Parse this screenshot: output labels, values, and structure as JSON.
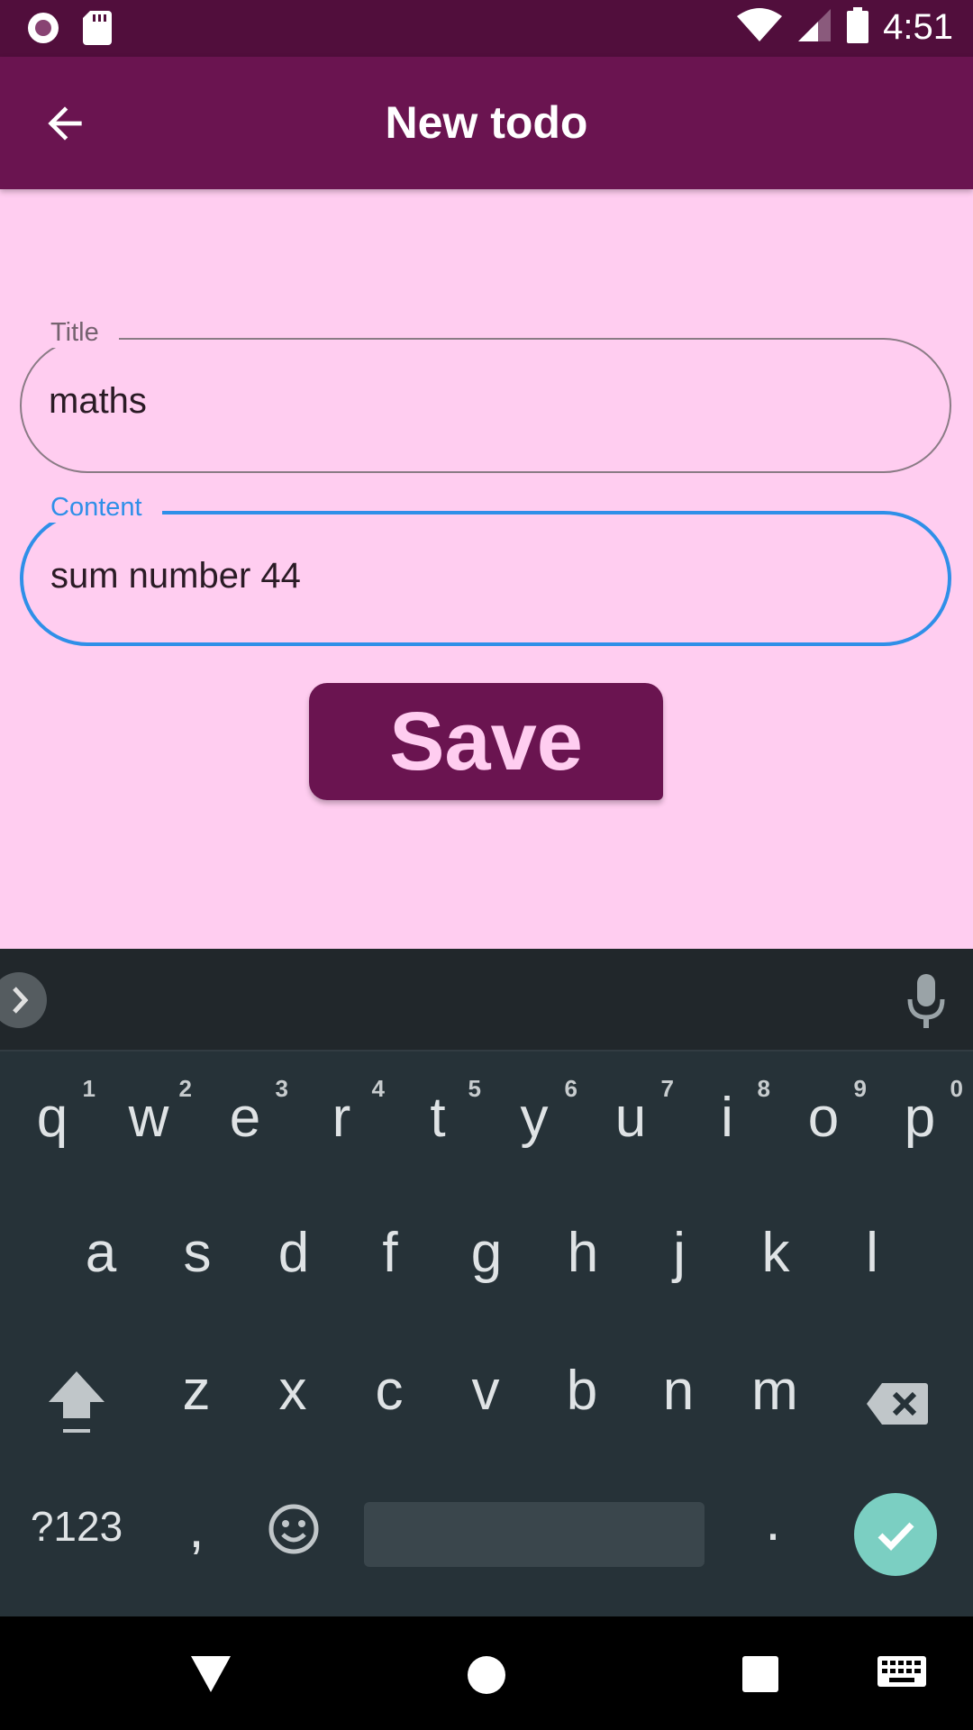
{
  "status_bar": {
    "time": "4:51"
  },
  "app_bar": {
    "title": "New todo"
  },
  "form": {
    "title_label": "Title",
    "title_value": "maths",
    "content_label": "Content",
    "content_value": "sum number 44",
    "save_label": "Save"
  },
  "keyboard": {
    "row1": [
      {
        "key": "q",
        "hint": "1"
      },
      {
        "key": "w",
        "hint": "2"
      },
      {
        "key": "e",
        "hint": "3"
      },
      {
        "key": "r",
        "hint": "4"
      },
      {
        "key": "t",
        "hint": "5"
      },
      {
        "key": "y",
        "hint": "6"
      },
      {
        "key": "u",
        "hint": "7"
      },
      {
        "key": "i",
        "hint": "8"
      },
      {
        "key": "o",
        "hint": "9"
      },
      {
        "key": "p",
        "hint": "0"
      }
    ],
    "row2": [
      "a",
      "s",
      "d",
      "f",
      "g",
      "h",
      "j",
      "k",
      "l"
    ],
    "row3": [
      "z",
      "x",
      "c",
      "v",
      "b",
      "n",
      "m"
    ],
    "symbols_label": "?123",
    "comma": ",",
    "period": "."
  },
  "colors": {
    "app_bar": "#6a1450",
    "status_bar": "#510e3c",
    "background": "#ffcdf0",
    "focus_accent": "#2f8fe8",
    "keyboard": "#263238",
    "enter_key": "#7bcfc2"
  }
}
